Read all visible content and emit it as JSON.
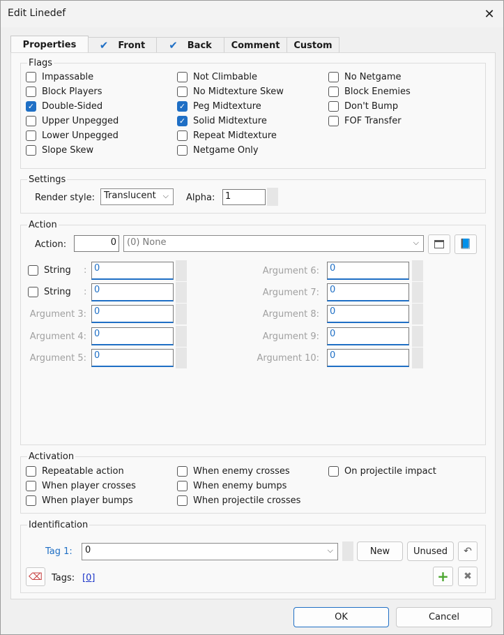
{
  "window": {
    "title": "Edit Linedef"
  },
  "tabs": [
    {
      "label": "Properties",
      "checked": false,
      "active": true
    },
    {
      "label": "Front",
      "checked": true,
      "active": false
    },
    {
      "label": "Back",
      "checked": true,
      "active": false
    },
    {
      "label": "Comment",
      "checked": false,
      "active": false
    },
    {
      "label": "Custom",
      "checked": false,
      "active": false
    }
  ],
  "flags": {
    "title": "Flags",
    "items": [
      {
        "label": "Impassable",
        "checked": false
      },
      {
        "label": "Block Players",
        "checked": false
      },
      {
        "label": "Double-Sided",
        "checked": true
      },
      {
        "label": "Upper Unpegged",
        "checked": false
      },
      {
        "label": "Lower Unpegged",
        "checked": false
      },
      {
        "label": "Slope Skew",
        "checked": false
      },
      {
        "label": "Not Climbable",
        "checked": false
      },
      {
        "label": "No Midtexture Skew",
        "checked": false
      },
      {
        "label": "Peg Midtexture",
        "checked": true
      },
      {
        "label": "Solid Midtexture",
        "checked": true
      },
      {
        "label": "Repeat Midtexture",
        "checked": false
      },
      {
        "label": "Netgame Only",
        "checked": false
      },
      {
        "label": "No Netgame",
        "checked": false
      },
      {
        "label": "Block Enemies",
        "checked": false
      },
      {
        "label": "Don't Bump",
        "checked": false
      },
      {
        "label": "FOF Transfer",
        "checked": false
      }
    ]
  },
  "settings": {
    "title": "Settings",
    "render_style_label": "Render style:",
    "render_style_value": "Translucent",
    "alpha_label": "Alpha:",
    "alpha_value": "1"
  },
  "action": {
    "title": "Action",
    "action_label": "Action:",
    "action_number": "0",
    "action_select": "(0) None",
    "args_left": [
      {
        "label": "String",
        "colon": ":",
        "value": "0",
        "is_checkbox": true
      },
      {
        "label": "String",
        "colon": ":",
        "value": "0",
        "is_checkbox": true
      },
      {
        "label": "Argument 3:",
        "value": "0",
        "is_checkbox": false
      },
      {
        "label": "Argument 4:",
        "value": "0",
        "is_checkbox": false
      },
      {
        "label": "Argument 5:",
        "value": "0",
        "is_checkbox": false
      }
    ],
    "args_right": [
      {
        "label": "Argument 6:",
        "value": "0"
      },
      {
        "label": "Argument 7:",
        "value": "0"
      },
      {
        "label": "Argument 8:",
        "value": "0"
      },
      {
        "label": "Argument 9:",
        "value": "0"
      },
      {
        "label": "Argument 10:",
        "value": "0"
      }
    ]
  },
  "activation": {
    "title": "Activation",
    "items": [
      {
        "label": "Repeatable action",
        "checked": false
      },
      {
        "label": "When player crosses",
        "checked": false
      },
      {
        "label": "When player bumps",
        "checked": false
      },
      {
        "label": "When enemy crosses",
        "checked": false
      },
      {
        "label": "When enemy bumps",
        "checked": false
      },
      {
        "label": "When projectile crosses",
        "checked": false
      },
      {
        "label": "On projectile impact",
        "checked": false
      }
    ]
  },
  "identification": {
    "title": "Identification",
    "tag_label": "Tag 1:",
    "tag_value": "0",
    "new_label": "New",
    "unused_label": "Unused",
    "tags_label": "Tags:",
    "tags_link": "[0]"
  },
  "footer": {
    "ok_label": "OK",
    "cancel_label": "Cancel"
  }
}
